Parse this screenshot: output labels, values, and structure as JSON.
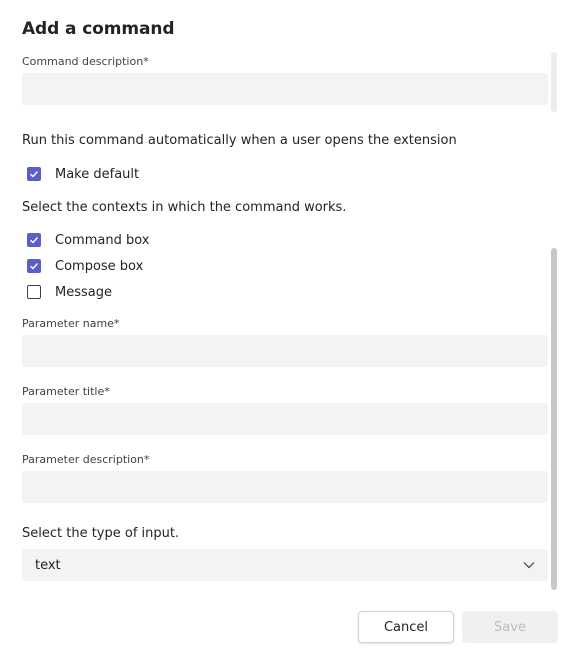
{
  "dialog": {
    "title": "Add a command"
  },
  "form": {
    "command_description": {
      "label": "Command description",
      "required_mark": "*",
      "value": ""
    },
    "auto_run_text": "Run this command automatically when a user opens the extension",
    "make_default": {
      "label": "Make default",
      "checked": true
    },
    "contexts_text": "Select the contexts in which the command works.",
    "contexts": [
      {
        "label": "Command box",
        "checked": true
      },
      {
        "label": "Compose box",
        "checked": true
      },
      {
        "label": "Message",
        "checked": false
      }
    ],
    "parameter_name": {
      "label": "Parameter name",
      "required_mark": "*",
      "value": ""
    },
    "parameter_title": {
      "label": "Parameter title",
      "required_mark": "*",
      "value": ""
    },
    "parameter_description": {
      "label": "Parameter description",
      "required_mark": "*",
      "value": ""
    },
    "input_type_text": "Select the type of input.",
    "input_type": {
      "selected": "text",
      "icon": "chevron-down-icon"
    }
  },
  "footer": {
    "cancel_label": "Cancel",
    "save_label": "Save"
  },
  "colors": {
    "accent": "#5b5fc7",
    "input_bg": "#f3f3f3",
    "disabled_text": "#bdbdbd"
  }
}
